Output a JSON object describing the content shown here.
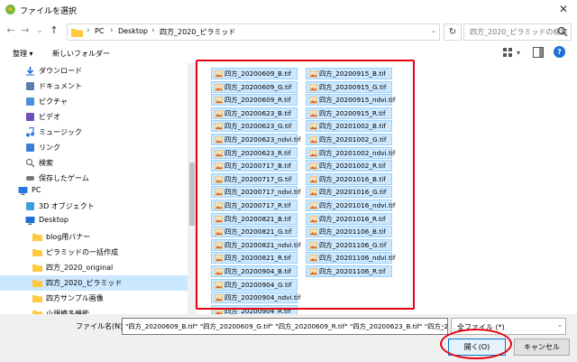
{
  "window": {
    "title": "ファイルを選択",
    "close_glyph": "✕"
  },
  "nav_buttons": {
    "back": "←",
    "forward": "→",
    "dropdown": "⌄",
    "up": "↑"
  },
  "address": {
    "parts": [
      "PC",
      "Desktop",
      "四方_2020_ピラミッド"
    ],
    "sep": "›",
    "dropdown": "⌄",
    "refresh": "↻"
  },
  "search": {
    "placeholder": "四方_2020_ピラミッドの検索"
  },
  "toolbar": {
    "organize": "整理 ▾",
    "new_folder": "新しいフォルダー",
    "view_dd": "▾",
    "help": "?"
  },
  "navigation": [
    {
      "label": "ダウンロード",
      "icon": "download-icon"
    },
    {
      "label": "ドキュメント",
      "icon": "document-icon"
    },
    {
      "label": "ピクチャ",
      "icon": "pictures-icon"
    },
    {
      "label": "ビデオ",
      "icon": "video-icon"
    },
    {
      "label": "ミュージック",
      "icon": "music-icon"
    },
    {
      "label": "リンク",
      "icon": "link-icon"
    },
    {
      "label": "検索",
      "icon": "search-icon"
    },
    {
      "label": "保存したゲーム",
      "icon": "games-icon"
    },
    {
      "label": "PC",
      "icon": "pc-icon"
    },
    {
      "label": "3D オブジェクト",
      "icon": "3d-objects-icon"
    },
    {
      "label": "Desktop",
      "icon": "desktop-icon"
    },
    {
      "label": "blog用バナー",
      "icon": "folder-icon"
    },
    {
      "label": "ピラミッドの一括作成",
      "icon": "folder-icon"
    },
    {
      "label": "四方_2020_original",
      "icon": "folder-icon"
    },
    {
      "label": "四方_2020_ピラミッド",
      "icon": "folder-icon",
      "selected": true
    },
    {
      "label": "四方サンプル画像",
      "icon": "folder-icon"
    },
    {
      "label": "小規模多機能",
      "icon": "folder-icon"
    }
  ],
  "files_col1": [
    "四方_20200609_B.tif",
    "四方_20200609_G.tif",
    "四方_20200609_R.tif",
    "四方_20200623_B.tif",
    "四方_20200623_G.tif",
    "四方_20200623_ndvi.tif",
    "四方_20200623_R.tif",
    "四方_20200717_B.tif",
    "四方_20200717_G.tif",
    "四方_20200717_ndvi.tif",
    "四方_20200717_R.tif",
    "四方_20200821_B.tif",
    "四方_20200821_G.tif",
    "四方_20200821_ndvi.tif",
    "四方_20200821_R.tif",
    "四方_20200904_B.tif",
    "四方_20200904_G.tif",
    "四方_20200904_ndvi.tif",
    "四方_20200904_R.tif"
  ],
  "files_col2": [
    "四方_20200915_B.tif",
    "四方_20200915_G.tif",
    "四方_20200915_ndvi.tif",
    "四方_20200915_R.tif",
    "四方_20201002_B.tif",
    "四方_20201002_G.tif",
    "四方_20201002_ndvi.tif",
    "四方_20201002_R.tif",
    "四方_20201016_B.tif",
    "四方_20201016_G.tif",
    "四方_20201016_ndvi.tif",
    "四方_20201016_R.tif",
    "四方_20201106_B.tif",
    "四方_20201106_G.tif",
    "四方_20201106_ndvi.tif",
    "四方_20201106_R.tif"
  ],
  "bottom": {
    "filename_label": "ファイル名(N):",
    "filename_value": "\"四方_20200609_B.tif\" \"四方_20200609_G.tif\" \"四方_20200609_R.tif\" \"四方_20200623_B.tif\" \"四方_2",
    "filter_value": "全ファイル (*)",
    "open_label": "開く(O)",
    "cancel_label": "キャンセル",
    "dropdown": "⌄"
  },
  "colors": {
    "selection": "#cce8ff",
    "annotation": "#e60012",
    "folder": "#ffc83d"
  }
}
